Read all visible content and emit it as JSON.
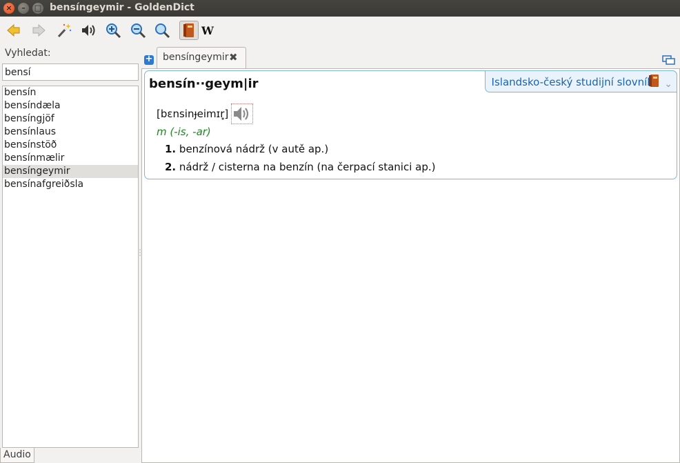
{
  "window": {
    "title": "bensíngeymir - GoldenDict",
    "close_glyph": "×",
    "minimize_glyph": "–",
    "maximize_glyph": "□"
  },
  "toolbar": {
    "buttons": [
      {
        "name": "back",
        "icon": "arrow-left-icon"
      },
      {
        "name": "forward",
        "icon": "arrow-right-icon"
      },
      {
        "name": "scan-popup",
        "icon": "magic-wand-icon"
      },
      {
        "name": "pronounce",
        "icon": "speaker-icon"
      },
      {
        "name": "zoom-in",
        "icon": "zoom-in-icon"
      },
      {
        "name": "zoom-out",
        "icon": "zoom-out-icon"
      },
      {
        "name": "zoom-normal",
        "icon": "zoom-normal-icon"
      },
      {
        "name": "dictionary-bar",
        "icon": "book-icon"
      },
      {
        "name": "wikipedia",
        "icon": "wikipedia-icon"
      }
    ],
    "wiki_glyph": "W"
  },
  "search": {
    "label": "Vyhledat:",
    "value": "bensí"
  },
  "word_list": {
    "items": [
      "bensín",
      "bensíndæla",
      "bensíngjöf",
      "bensínlaus",
      "bensínstöð",
      "bensínmælir",
      "bensíngeymir",
      "bensínafgreiðsla"
    ],
    "selected": "bensíngeymir"
  },
  "bottom_tab": {
    "label": "Audio"
  },
  "tabs": {
    "new_tab_glyph": "+",
    "items": [
      {
        "label": "bensíngeymir",
        "close_glyph": "✖"
      }
    ]
  },
  "article": {
    "dictionary_name": "Islandsko-český studijní slovník",
    "chevron_glyph": "⌄",
    "headword": "bensín··geym|ir",
    "pronunciation": "[bɛnsinɟeimɪr̥]",
    "grammar": "m (-is, -ar)",
    "senses": [
      {
        "num": "1.",
        "text": "benzínová nádrž (v autě ap.)"
      },
      {
        "num": "2.",
        "text": "nádrž / cisterna na benzín (na čerpací stanici ap.)"
      }
    ]
  },
  "colors": {
    "titlebar": "#3c3b37",
    "link_blue": "#1a64b4",
    "grammar_green": "#1b8a1b",
    "frame_blue": "#7fb5d8"
  }
}
